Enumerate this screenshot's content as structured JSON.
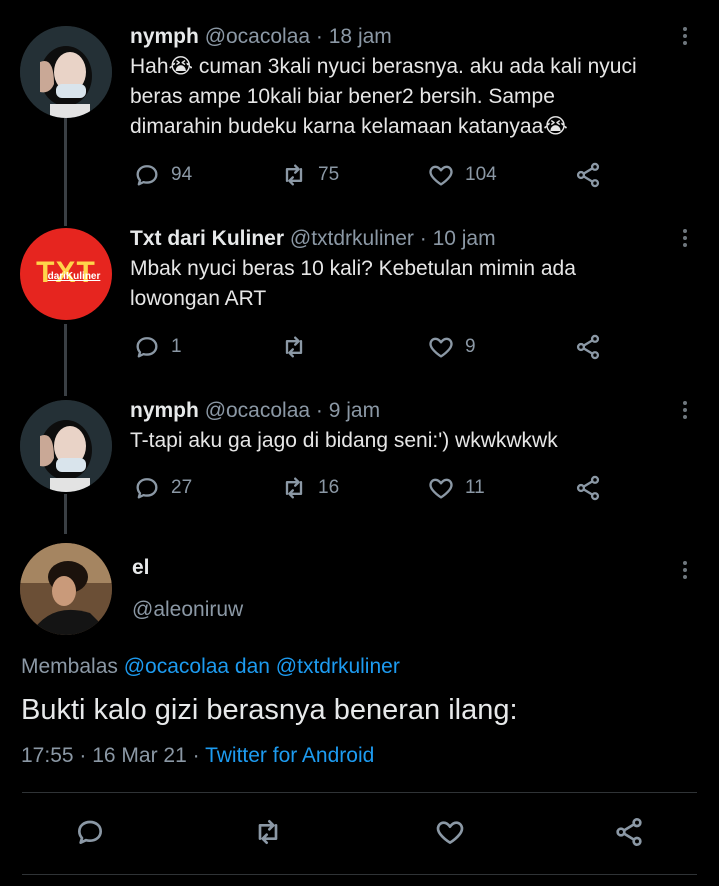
{
  "tweets": [
    {
      "display_name": "nymph",
      "handle": "@ocacolaa",
      "time": "· 18 jam",
      "lines": [
        "Hah😭 cuman 3kali nyuci berasnya. aku ada kali nyuci",
        "beras ampe 10kali biar bener2 bersih. Sampe",
        "dimarahin budeku karna kelamaan katanyaa😭"
      ],
      "replies": "94",
      "retweets": "75",
      "likes": "104"
    },
    {
      "display_name": "Txt dari Kuliner",
      "handle": "@txtdrkuliner",
      "time": "· 10 jam",
      "lines": [
        "Mbak nyuci beras 10 kali? Kebetulan mimin ada",
        "lowongan ART"
      ],
      "replies": "1",
      "retweets": "",
      "likes": "9",
      "avatar_logo_main": "TXT",
      "avatar_logo_sub": "dariKuliner"
    },
    {
      "display_name": "nymph",
      "handle": "@ocacolaa",
      "time": "· 9 jam",
      "lines": [
        "T-tapi aku ga jago di bidang seni:') wkwkwkwk"
      ],
      "replies": "27",
      "retweets": "16",
      "likes": "11"
    }
  ],
  "main_tweet": {
    "display_name": "el",
    "handle": "@aleoniruw",
    "reply_prefix": "Membalas",
    "reply_to": "@ocacolaa dan @txtdrkuliner",
    "text": "Bukti kalo gizi berasnya beneran ilang:",
    "timestamp": "17:55 · 16 Mar 21 ·",
    "source": "Twitter for Android"
  },
  "icons": {
    "reply": "reply-icon",
    "retweet": "retweet-icon",
    "like": "heart-icon",
    "share": "share-icon",
    "more": "more-icon"
  },
  "colors": {
    "background": "#000000",
    "link": "#1d9bf0",
    "muted": "#8b98a5",
    "txt_brand": "#e6251f"
  }
}
